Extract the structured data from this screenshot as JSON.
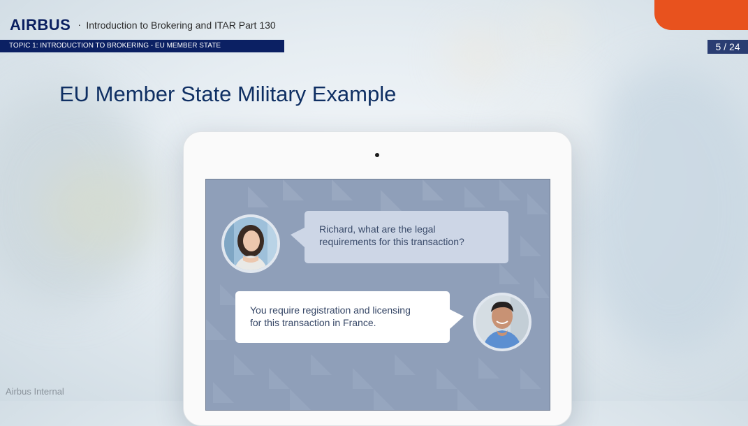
{
  "header": {
    "logo": "AIRBUS",
    "course_title": "Introduction to Brokering and ITAR Part 130"
  },
  "topic_bar": {
    "label": "TOPIC 1: INTRODUCTION TO BROKERING - EU MEMBER STATE"
  },
  "page_counter": {
    "label": "5 / 24"
  },
  "slide": {
    "title": "EU Member State Military Example"
  },
  "chat": {
    "question": {
      "line1": "Richard, what are the legal",
      "line2": "requirements for this transaction?"
    },
    "answer": {
      "line1": "You require registration and licensing",
      "line2": "for this transaction in France."
    }
  },
  "footer": {
    "label": "Airbus Internal"
  },
  "colors": {
    "brand_navy": "#0b2063",
    "accent_orange": "#e8521e",
    "screen_bg": "#8f9fb9"
  }
}
